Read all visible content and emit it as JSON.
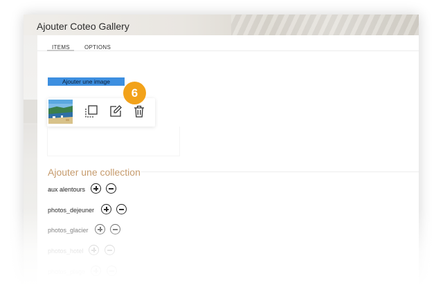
{
  "window": {
    "title": "Ajouter Coteo Gallery"
  },
  "tabs": [
    {
      "label": "ITEMS",
      "active": true
    },
    {
      "label": "OPTIONS",
      "active": false
    }
  ],
  "add_image_button": {
    "label": "Ajouter une image"
  },
  "image_item": {
    "actions": [
      "crop-icon",
      "edit-icon",
      "trash-icon"
    ]
  },
  "step_badge": {
    "number": "6",
    "color": "#f2a21a"
  },
  "collection": {
    "heading": "Ajouter une collection",
    "items": [
      {
        "label": "aux alentours"
      },
      {
        "label": "photos_dejeuner"
      },
      {
        "label": "photos_glacier"
      },
      {
        "label": "photos_hotel"
      },
      {
        "label": "photos_plage"
      }
    ]
  },
  "colors": {
    "accent_blue": "#3d8fe0",
    "heading_gold": "#c69b6d",
    "badge_orange": "#f2a21a"
  }
}
